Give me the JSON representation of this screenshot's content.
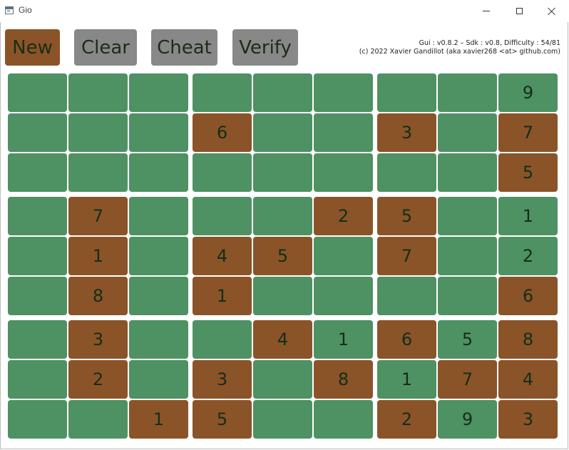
{
  "window": {
    "title": "Gio"
  },
  "toolbar": {
    "new_label": "New",
    "clear_label": "Clear",
    "cheat_label": "Cheat",
    "verify_label": "Verify"
  },
  "info": {
    "version_line": "Gui : v0.8.2 – Sdk : v0.8, Difficulty : 54/81",
    "copyright_line": "(c) 2022 Xavier Gandillot (aka xavier268 <at> github.com)"
  },
  "colors": {
    "given_cell": "#4e9163",
    "user_cell": "#8a5428",
    "button_active": "#8a5428",
    "button_inactive": "#888888"
  },
  "board": {
    "rows": [
      [
        {
          "v": "",
          "c": "g"
        },
        {
          "v": "",
          "c": "g"
        },
        {
          "v": "",
          "c": "g"
        },
        {
          "v": "",
          "c": "g"
        },
        {
          "v": "",
          "c": "g"
        },
        {
          "v": "",
          "c": "g"
        },
        {
          "v": "",
          "c": "g"
        },
        {
          "v": "",
          "c": "g"
        },
        {
          "v": "9",
          "c": "g"
        }
      ],
      [
        {
          "v": "",
          "c": "g"
        },
        {
          "v": "",
          "c": "g"
        },
        {
          "v": "",
          "c": "g"
        },
        {
          "v": "6",
          "c": "b"
        },
        {
          "v": "",
          "c": "g"
        },
        {
          "v": "",
          "c": "g"
        },
        {
          "v": "3",
          "c": "b"
        },
        {
          "v": "",
          "c": "g"
        },
        {
          "v": "7",
          "c": "b"
        }
      ],
      [
        {
          "v": "",
          "c": "g"
        },
        {
          "v": "",
          "c": "g"
        },
        {
          "v": "",
          "c": "g"
        },
        {
          "v": "",
          "c": "g"
        },
        {
          "v": "",
          "c": "g"
        },
        {
          "v": "",
          "c": "g"
        },
        {
          "v": "",
          "c": "g"
        },
        {
          "v": "",
          "c": "g"
        },
        {
          "v": "5",
          "c": "b"
        }
      ],
      [
        {
          "v": "",
          "c": "g"
        },
        {
          "v": "7",
          "c": "b"
        },
        {
          "v": "",
          "c": "g"
        },
        {
          "v": "",
          "c": "g"
        },
        {
          "v": "",
          "c": "g"
        },
        {
          "v": "2",
          "c": "b"
        },
        {
          "v": "5",
          "c": "b"
        },
        {
          "v": "",
          "c": "g"
        },
        {
          "v": "1",
          "c": "g"
        }
      ],
      [
        {
          "v": "",
          "c": "g"
        },
        {
          "v": "1",
          "c": "b"
        },
        {
          "v": "",
          "c": "g"
        },
        {
          "v": "4",
          "c": "b"
        },
        {
          "v": "5",
          "c": "b"
        },
        {
          "v": "",
          "c": "g"
        },
        {
          "v": "7",
          "c": "b"
        },
        {
          "v": "",
          "c": "g"
        },
        {
          "v": "2",
          "c": "g"
        }
      ],
      [
        {
          "v": "",
          "c": "g"
        },
        {
          "v": "8",
          "c": "b"
        },
        {
          "v": "",
          "c": "g"
        },
        {
          "v": "1",
          "c": "b"
        },
        {
          "v": "",
          "c": "g"
        },
        {
          "v": "",
          "c": "g"
        },
        {
          "v": "",
          "c": "g"
        },
        {
          "v": "",
          "c": "g"
        },
        {
          "v": "6",
          "c": "b"
        }
      ],
      [
        {
          "v": "",
          "c": "g"
        },
        {
          "v": "3",
          "c": "b"
        },
        {
          "v": "",
          "c": "g"
        },
        {
          "v": "",
          "c": "g"
        },
        {
          "v": "4",
          "c": "b"
        },
        {
          "v": "1",
          "c": "g"
        },
        {
          "v": "6",
          "c": "b"
        },
        {
          "v": "5",
          "c": "g"
        },
        {
          "v": "8",
          "c": "b"
        }
      ],
      [
        {
          "v": "",
          "c": "g"
        },
        {
          "v": "2",
          "c": "b"
        },
        {
          "v": "",
          "c": "g"
        },
        {
          "v": "3",
          "c": "b"
        },
        {
          "v": "",
          "c": "g"
        },
        {
          "v": "8",
          "c": "b"
        },
        {
          "v": "1",
          "c": "g"
        },
        {
          "v": "7",
          "c": "b"
        },
        {
          "v": "4",
          "c": "b"
        }
      ],
      [
        {
          "v": "",
          "c": "g"
        },
        {
          "v": "",
          "c": "g"
        },
        {
          "v": "1",
          "c": "b"
        },
        {
          "v": "5",
          "c": "b"
        },
        {
          "v": "",
          "c": "g"
        },
        {
          "v": "",
          "c": "g"
        },
        {
          "v": "2",
          "c": "b"
        },
        {
          "v": "9",
          "c": "g"
        },
        {
          "v": "3",
          "c": "b"
        }
      ]
    ]
  }
}
